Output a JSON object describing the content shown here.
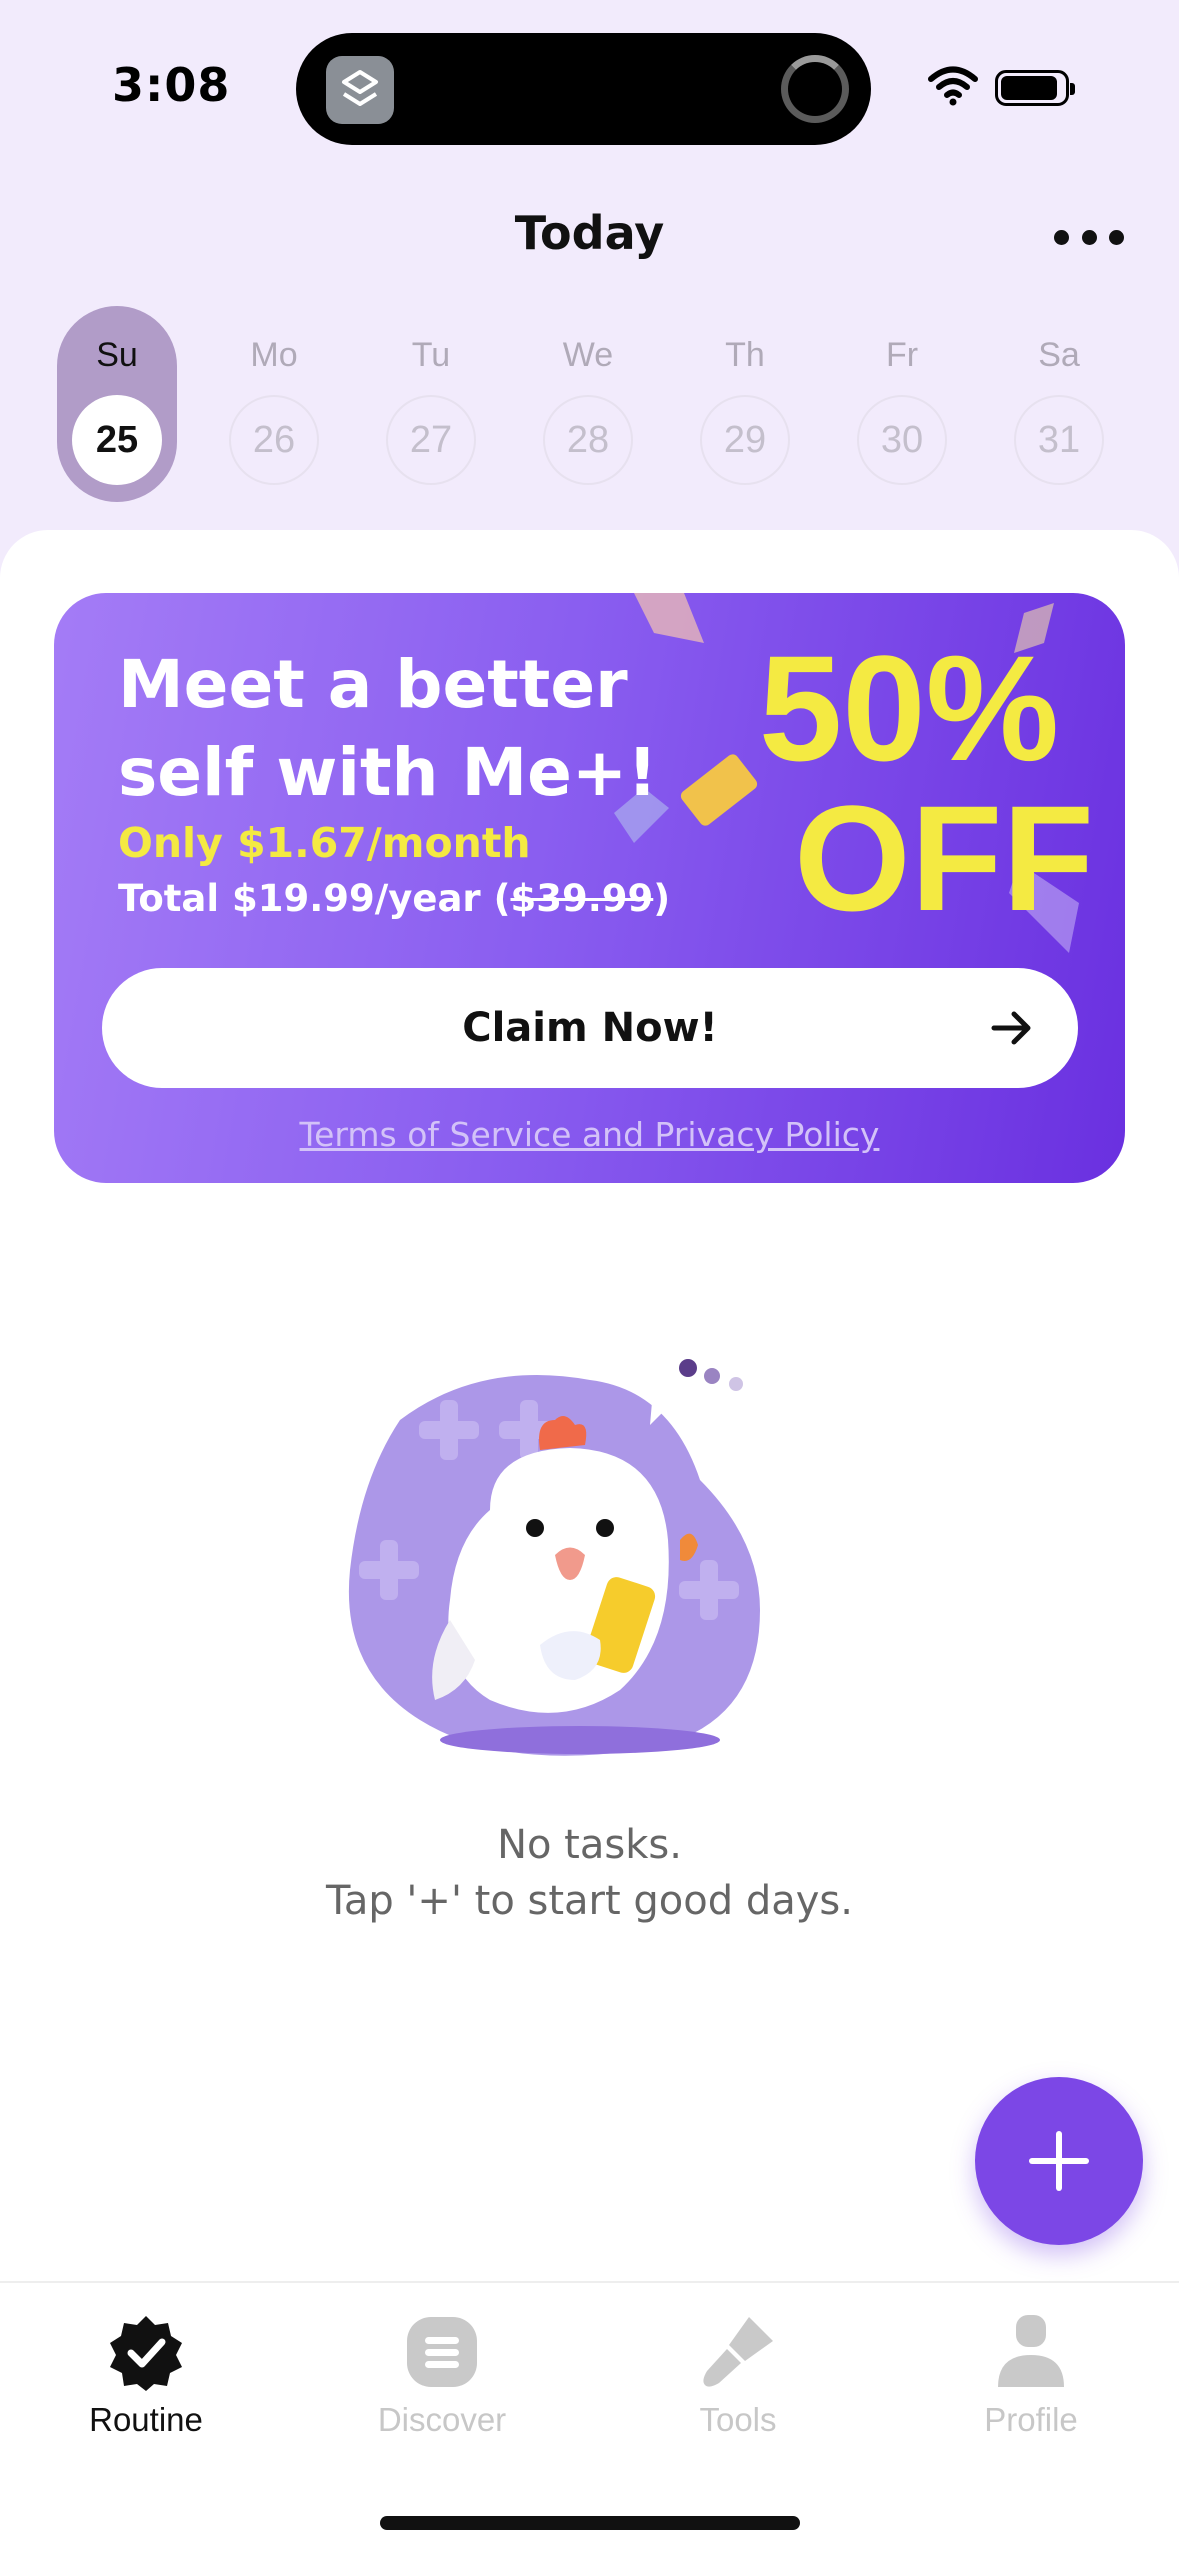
{
  "status_bar": {
    "time": "3:08"
  },
  "header": {
    "title": "Today"
  },
  "week": [
    {
      "name": "Su",
      "date": "25",
      "selected": true
    },
    {
      "name": "Mo",
      "date": "26",
      "selected": false
    },
    {
      "name": "Tu",
      "date": "27",
      "selected": false
    },
    {
      "name": "We",
      "date": "28",
      "selected": false
    },
    {
      "name": "Th",
      "date": "29",
      "selected": false
    },
    {
      "name": "Fr",
      "date": "30",
      "selected": false
    },
    {
      "name": "Sa",
      "date": "31",
      "selected": false
    }
  ],
  "promo": {
    "title_line1": "Meet a better",
    "title_line2": "self with Me+!",
    "price": "Only $1.67/month",
    "total_prefix": "Total $19.99/year (",
    "total_original": "$39.99",
    "total_suffix": ")",
    "discount": "50%",
    "discount_suffix": "OFF",
    "claim_label": "Claim Now!",
    "terms": "Terms of Service and Privacy Policy"
  },
  "empty_state": {
    "line1": "No tasks.",
    "line2": "Tap '+' to start good days."
  },
  "tabs": [
    {
      "label": "Routine",
      "icon": "checkmark-badge-icon",
      "active": true
    },
    {
      "label": "Discover",
      "icon": "list-icon",
      "active": false
    },
    {
      "label": "Tools",
      "icon": "brush-icon",
      "active": false
    },
    {
      "label": "Profile",
      "icon": "person-icon",
      "active": false
    }
  ],
  "colors": {
    "accent": "#7c47e6",
    "header_bg": "#f2ebfc",
    "promo_yellow": "#f4ea42",
    "selected_day": "#b19cc8"
  }
}
